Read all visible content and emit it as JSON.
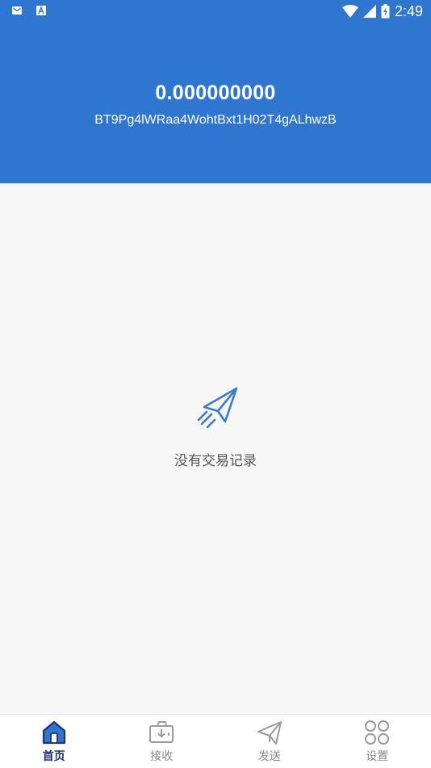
{
  "status_bar": {
    "time": "2:49",
    "left_icons": [
      "mail-icon",
      "text-icon"
    ],
    "right_icons": [
      "wifi-icon",
      "signal-icon",
      "battery-charging-icon"
    ]
  },
  "wallet": {
    "balance": "0.000000000",
    "address": "BT9Pg4lWRaa4WohtBxt1H02T4gALhwzB"
  },
  "empty_state": {
    "icon": "rocket-icon",
    "message": "没有交易记录"
  },
  "bottom_nav": {
    "active_index": 0,
    "accent_color": "#1f3570",
    "items": [
      {
        "label": "首页",
        "icon": "home-icon"
      },
      {
        "label": "接收",
        "icon": "receive-wallet-icon"
      },
      {
        "label": "发送",
        "icon": "send-plane-icon"
      },
      {
        "label": "设置",
        "icon": "settings-grid-icon"
      }
    ]
  },
  "colors": {
    "header_bg": "#2e76cf",
    "page_bg": "#f7f7f7"
  }
}
